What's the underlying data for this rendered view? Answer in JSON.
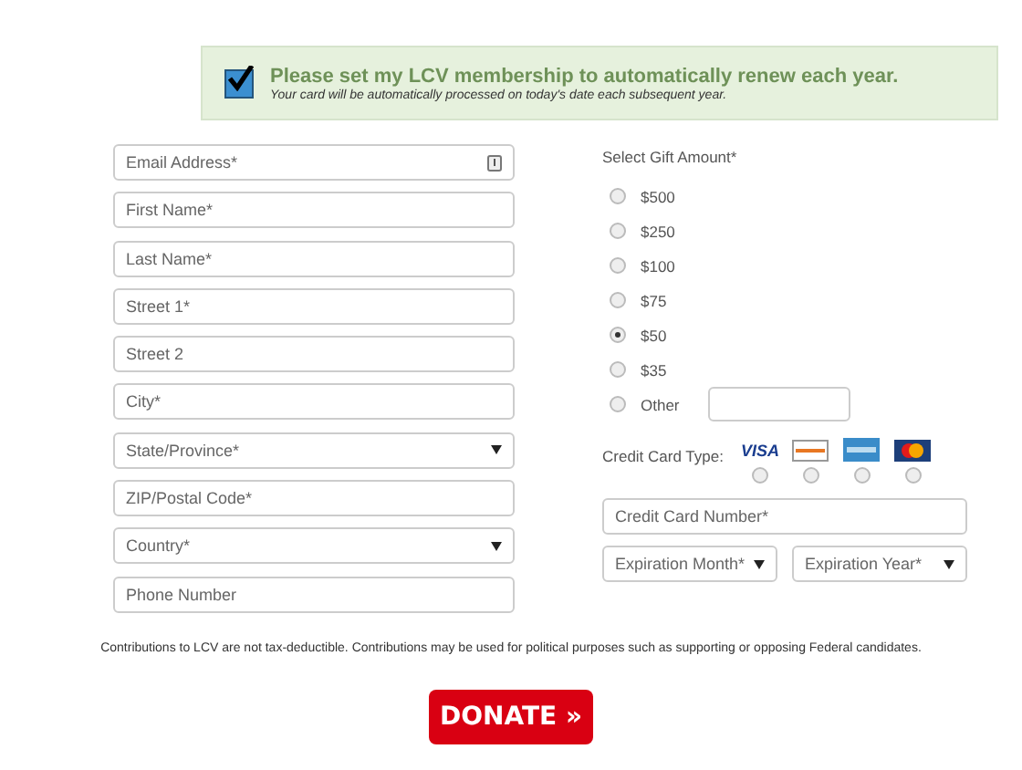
{
  "renewal": {
    "checked": true,
    "title": "Please set my LCV membership to automatically renew each year.",
    "note": "Your card will be automatically processed on today's date each subsequent year."
  },
  "contact_fields": [
    {
      "kind": "email",
      "placeholder": "Email Address*"
    },
    {
      "kind": "text",
      "placeholder": "First Name*"
    },
    {
      "kind": "text",
      "placeholder": "Last Name*"
    },
    {
      "kind": "text",
      "placeholder": "Street 1*"
    },
    {
      "kind": "text",
      "placeholder": "Street 2"
    },
    {
      "kind": "text",
      "placeholder": "City*"
    },
    {
      "kind": "select",
      "placeholder": "State/Province*"
    },
    {
      "kind": "text",
      "placeholder": "ZIP/Postal Code*"
    },
    {
      "kind": "select",
      "placeholder": "Country*"
    },
    {
      "kind": "text",
      "placeholder": "Phone Number"
    }
  ],
  "gift": {
    "label": "Select Gift Amount*",
    "options": [
      {
        "label": "$500",
        "selected": false
      },
      {
        "label": "$250",
        "selected": false
      },
      {
        "label": "$100",
        "selected": false
      },
      {
        "label": "$75",
        "selected": false
      },
      {
        "label": "$50",
        "selected": true
      },
      {
        "label": "$35",
        "selected": false
      },
      {
        "label": "Other",
        "selected": false,
        "kind": "other"
      }
    ]
  },
  "card_type": {
    "label": "Credit Card Type:",
    "cards": [
      {
        "kind": "visa",
        "label": "VISA",
        "selected": false
      },
      {
        "kind": "discover",
        "selected": false
      },
      {
        "kind": "amex",
        "selected": false
      },
      {
        "kind": "mastercard",
        "selected": false
      }
    ]
  },
  "card_number": {
    "placeholder": "Credit Card Number*"
  },
  "expiration": [
    {
      "placeholder": "Expiration Month*"
    },
    {
      "placeholder": "Expiration Year*"
    }
  ],
  "disclaimer": "Contributions to LCV are not tax-deductible. Contributions may be used for political purposes such as supporting or opposing Federal candidates.",
  "donate_button": "DONATE »"
}
